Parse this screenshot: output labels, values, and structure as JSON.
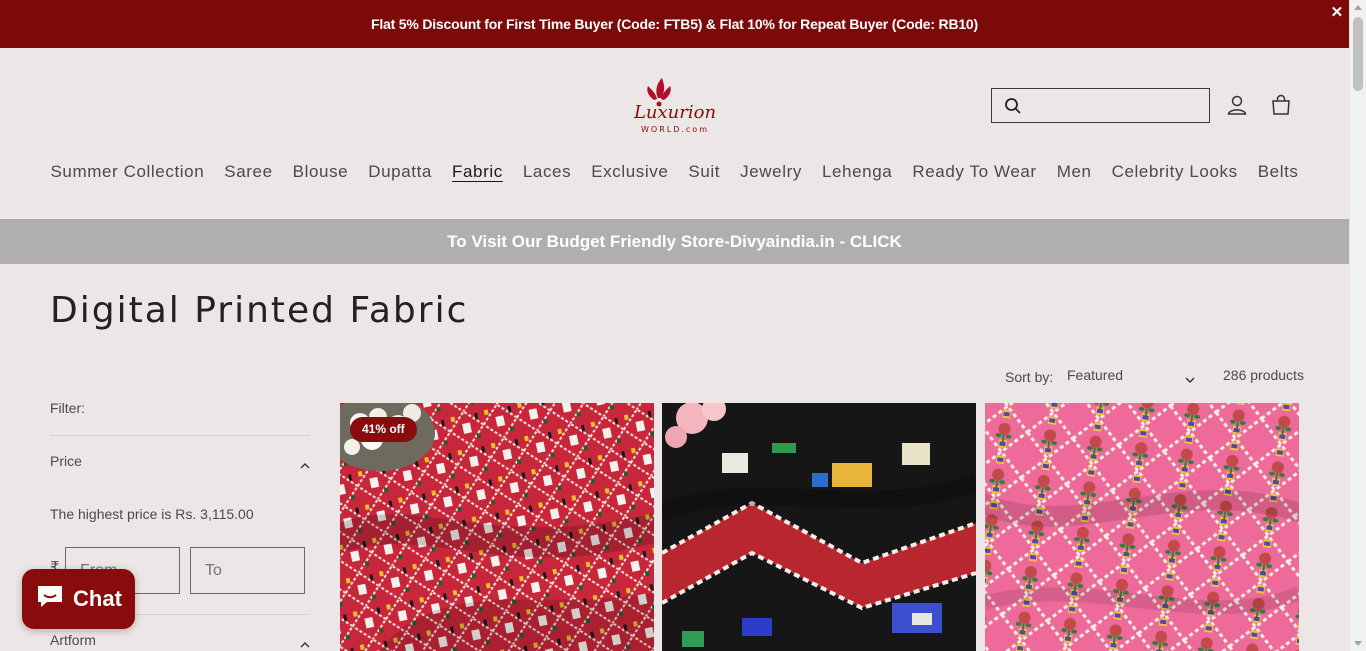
{
  "announcement": {
    "text": "Flat 5% Discount for First Time Buyer (Code: FTB5) & Flat 10% for Repeat Buyer (Code: RB10)",
    "close": "✕"
  },
  "brand": {
    "logo_alt": "Luxurion World.com",
    "logo_word": "Luxurion",
    "logo_sub": "WORLD.com",
    "accent": "#7d0a0a"
  },
  "search": {
    "placeholder": ""
  },
  "icons": {
    "search": "search-icon",
    "account": "account-icon",
    "cart": "cart-icon"
  },
  "nav": {
    "items": [
      "Summer Collection",
      "Saree",
      "Blouse",
      "Dupatta",
      "Fabric",
      "Laces",
      "Exclusive",
      "Suit",
      "Jewelry",
      "Lehenga",
      "Ready To Wear",
      "Men",
      "Celebrity Looks",
      "Belts"
    ],
    "active": "Fabric"
  },
  "promo": {
    "text": "To Visit Our Budget Friendly Store-Divyaindia.in - CLICK"
  },
  "collection": {
    "title": "Digital Printed Fabric"
  },
  "sort": {
    "label": "Sort by:",
    "selected": "Featured",
    "count": "286 products"
  },
  "filters": {
    "label": "Filter:",
    "price": {
      "heading": "Price",
      "note": "The highest price is Rs. 3,115.00",
      "currency": "₹",
      "from_placeholder": "From",
      "to_placeholder": "To"
    },
    "artform": {
      "heading": "Artform"
    }
  },
  "products": [
    {
      "badge": "41% off",
      "image": "red-patola-print-fabric"
    },
    {
      "badge": "",
      "image": "black-ikat-print-fabric"
    },
    {
      "badge": "",
      "image": "pink-patola-print-fabric"
    }
  ],
  "chat": {
    "label": "Chat"
  }
}
